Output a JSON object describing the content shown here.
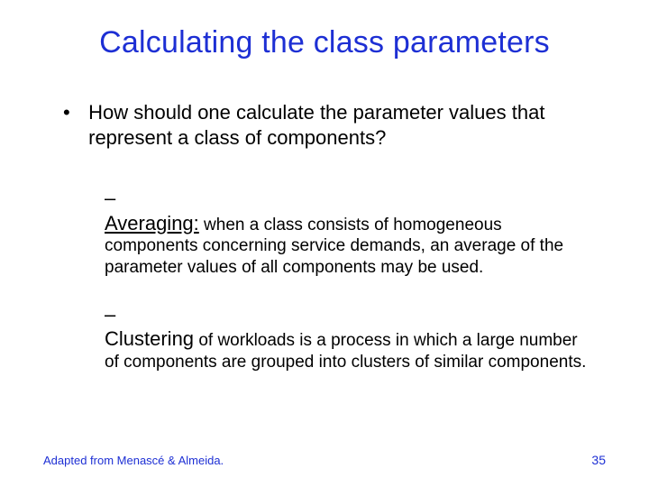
{
  "title": "Calculating the class parameters",
  "bullet1": "How should one calculate the parameter values that represent a class of components?",
  "sub1": {
    "lead": "Averaging:",
    "rest": " when a class consists of homogeneous components concerning service demands, an average of the parameter values of all components may be used."
  },
  "sub2": {
    "lead": "Clustering",
    "rest": " of workloads is a process in which a large number of components are grouped into clusters of similar components."
  },
  "footer_left": "Adapted from Menascé & Almeida.",
  "footer_right": "35"
}
